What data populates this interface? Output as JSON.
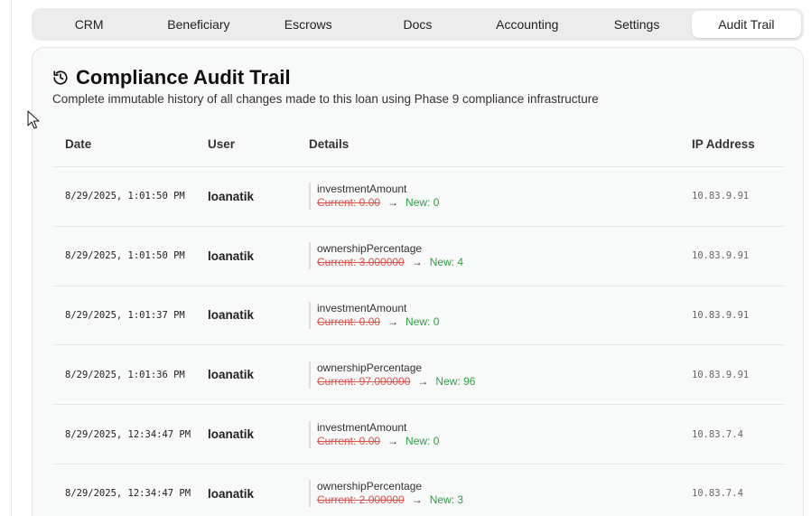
{
  "tabs": [
    {
      "label": "CRM",
      "active": false
    },
    {
      "label": "Beneficiary",
      "active": false
    },
    {
      "label": "Escrows",
      "active": false
    },
    {
      "label": "Docs",
      "active": false
    },
    {
      "label": "Accounting",
      "active": false
    },
    {
      "label": "Settings",
      "active": false
    },
    {
      "label": "Audit Trail",
      "active": true
    }
  ],
  "panel": {
    "icon": "history-icon",
    "title": "Compliance Audit Trail",
    "subtitle": "Complete immutable history of all changes made to this loan using Phase 9 compliance infrastructure"
  },
  "table": {
    "headers": {
      "date": "Date",
      "user": "User",
      "details": "Details",
      "ip": "IP Address"
    },
    "rows": [
      {
        "date": "8/29/2025, 1:01:50 PM",
        "user": "loanatik",
        "field": "investmentAmount",
        "old": "Current: 0.00",
        "new": "New: 0",
        "ip": "10.83.9.91"
      },
      {
        "date": "8/29/2025, 1:01:50 PM",
        "user": "loanatik",
        "field": "ownershipPercentage",
        "old": "Current: 3.000000",
        "new": "New: 4",
        "ip": "10.83.9.91"
      },
      {
        "date": "8/29/2025, 1:01:37 PM",
        "user": "loanatik",
        "field": "investmentAmount",
        "old": "Current: 0.00",
        "new": "New: 0",
        "ip": "10.83.9.91"
      },
      {
        "date": "8/29/2025, 1:01:36 PM",
        "user": "loanatik",
        "field": "ownershipPercentage",
        "old": "Current: 97.000000",
        "new": "New: 96",
        "ip": "10.83.9.91"
      },
      {
        "date": "8/29/2025, 12:34:47 PM",
        "user": "loanatik",
        "field": "investmentAmount",
        "old": "Current: 0.00",
        "new": "New: 0",
        "ip": "10.83.7.4"
      },
      {
        "date": "8/29/2025, 12:34:47 PM",
        "user": "loanatik",
        "field": "ownershipPercentage",
        "old": "Current: 2.000000",
        "new": "New: 3",
        "ip": "10.83.7.4"
      }
    ]
  },
  "colors": {
    "old_value": "#d9534f",
    "new_value": "#2f9e44"
  }
}
